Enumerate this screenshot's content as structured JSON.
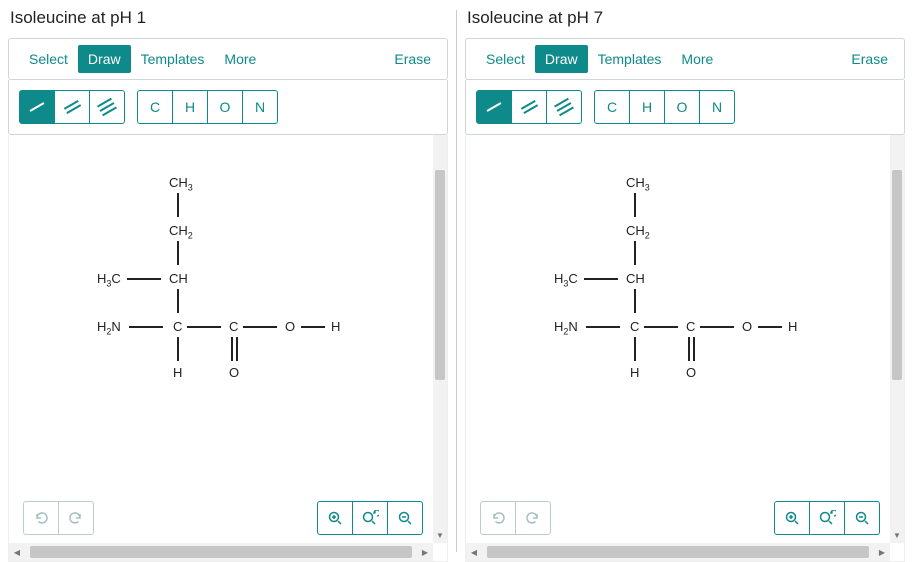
{
  "panels": [
    {
      "title": "Isoleucine at pH 1"
    },
    {
      "title": "Isoleucine at pH 7"
    }
  ],
  "tabs": {
    "select": "Select",
    "draw": "Draw",
    "templates": "Templates",
    "more": "More"
  },
  "erase": "Erase",
  "atoms": {
    "c": "C",
    "h": "H",
    "o": "O",
    "n": "N"
  },
  "mol": {
    "ch3": "CH",
    "ch3_sub": "3",
    "ch2": "CH",
    "ch2_sub": "2",
    "h3c": "H",
    "h3c_sub": "3",
    "h3c_tail": "C",
    "ch": "CH",
    "h2n": "H",
    "h2n_sub": "2",
    "h2n_tail": "N",
    "c": "C",
    "o": "O",
    "h": "H"
  }
}
